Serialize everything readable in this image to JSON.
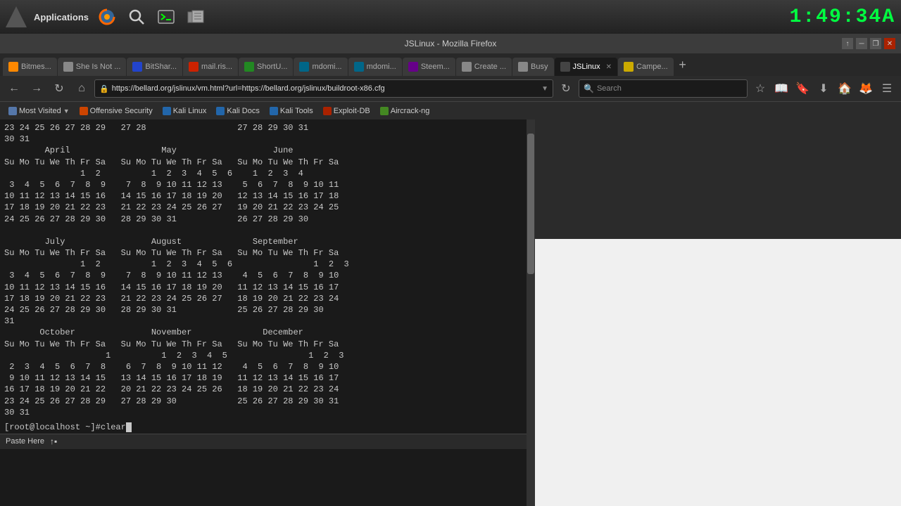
{
  "taskbar": {
    "apps_label": "Applications",
    "clock": "1:49:34A",
    "clock_display": "1:49:34A"
  },
  "browser": {
    "title": "JSLinux - Mozilla Firefox",
    "window_controls": [
      "↑",
      "─",
      "❐",
      "✕"
    ],
    "tabs": [
      {
        "id": "tab-bitmes",
        "label": "Bitmes...",
        "fav_class": "fav-orange",
        "active": false
      },
      {
        "id": "tab-sheis",
        "label": "She Is Not ...",
        "fav_class": "fav-gray",
        "active": false
      },
      {
        "id": "tab-bitshar",
        "label": "BitShar...",
        "fav_class": "fav-blue",
        "active": false
      },
      {
        "id": "tab-mail",
        "label": "mail.ris...",
        "fav_class": "fav-red",
        "active": false
      },
      {
        "id": "tab-shortu",
        "label": "ShortU...",
        "fav_class": "fav-green",
        "active": false
      },
      {
        "id": "tab-mdomi1",
        "label": "mdomi...",
        "fav_class": "fav-teal",
        "active": false
      },
      {
        "id": "tab-mdomi2",
        "label": "mdomi...",
        "fav_class": "fav-teal",
        "active": false
      },
      {
        "id": "tab-steem",
        "label": "Steem...",
        "fav_class": "fav-purple",
        "active": false
      },
      {
        "id": "tab-create",
        "label": "Create ...",
        "fav_class": "fav-gray",
        "active": false
      },
      {
        "id": "tab-busy",
        "label": "Busy",
        "fav_class": "fav-gray",
        "active": false
      },
      {
        "id": "tab-jslinux",
        "label": "JSLinux",
        "fav_class": "fav-jslinux",
        "active": true
      },
      {
        "id": "tab-campe",
        "label": "Campe...",
        "fav_class": "fav-yellow",
        "active": false
      }
    ],
    "url": "https://bellard.org/jslinux/vm.html?url=https://bellard.org/jslinux/buildroot-x86.cfg",
    "search_placeholder": "Search",
    "bookmarks": [
      {
        "label": "Most Visited",
        "has_arrow": true
      },
      {
        "label": "Offensive Security"
      },
      {
        "label": "Kali Linux"
      },
      {
        "label": "Kali Docs"
      },
      {
        "label": "Kali Tools"
      },
      {
        "label": "Exploit-DB"
      },
      {
        "label": "Aircrack-ng"
      }
    ]
  },
  "terminal": {
    "calendar_content": "23 24 25 26 27 28 29   27 28                  27 28 29 30 31\n30 31\n        April                  May                   June\nSu Mo Tu We Th Fr Sa   Su Mo Tu We Th Fr Sa   Su Mo Tu We Th Fr Sa\n               1  2          1  2  3  4  5  6    1  2  3  4\n 3  4  5  6  7  8  9    7  8  9 10 11 12 13    5  6  7  8  9 10 11\n10 11 12 13 14 15 16   14 15 16 17 18 19 20   12 13 14 15 16 17 18\n17 18 19 20 21 22 23   21 22 23 24 25 26 27   19 20 21 22 23 24 25\n24 25 26 27 28 29 30   28 29 30 31            26 27 28 29 30\n\n        July                 August              September\nSu Mo Tu We Th Fr Sa   Su Mo Tu We Th Fr Sa   Su Mo Tu We Th Fr Sa\n               1  2          1  2  3  4  5  6                1  2  3\n 3  4  5  6  7  8  9    7  8  9 10 11 12 13    4  5  6  7  8  9 10\n10 11 12 13 14 15 16   14 15 16 17 18 19 20   11 12 13 14 15 16 17\n17 18 19 20 21 22 23   21 22 23 24 25 26 27   18 19 20 21 22 23 24\n24 25 26 27 28 29 30   28 29 30 31            25 26 27 28 29 30\n31\n       October               November              December\nSu Mo Tu We Th Fr Sa   Su Mo Tu We Th Fr Sa   Su Mo Tu We Th Fr Sa\n                    1          1  2  3  4  5                1  2  3\n 2  3  4  5  6  7  8    6  7  8  9 10 11 12    4  5  6  7  8  9 10\n 9 10 11 12 13 14 15   13 14 15 16 17 18 19   11 12 13 14 15 16 17\n16 17 18 19 20 21 22   20 21 22 23 24 25 26   18 19 20 21 22 23 24\n23 24 25 26 27 28 29   27 28 29 30            25 26 27 28 29 30 31\n30 31",
    "command_prompt": "[root@localhost ~]# ",
    "command_text": "clear",
    "paste_label": "Paste Here"
  }
}
